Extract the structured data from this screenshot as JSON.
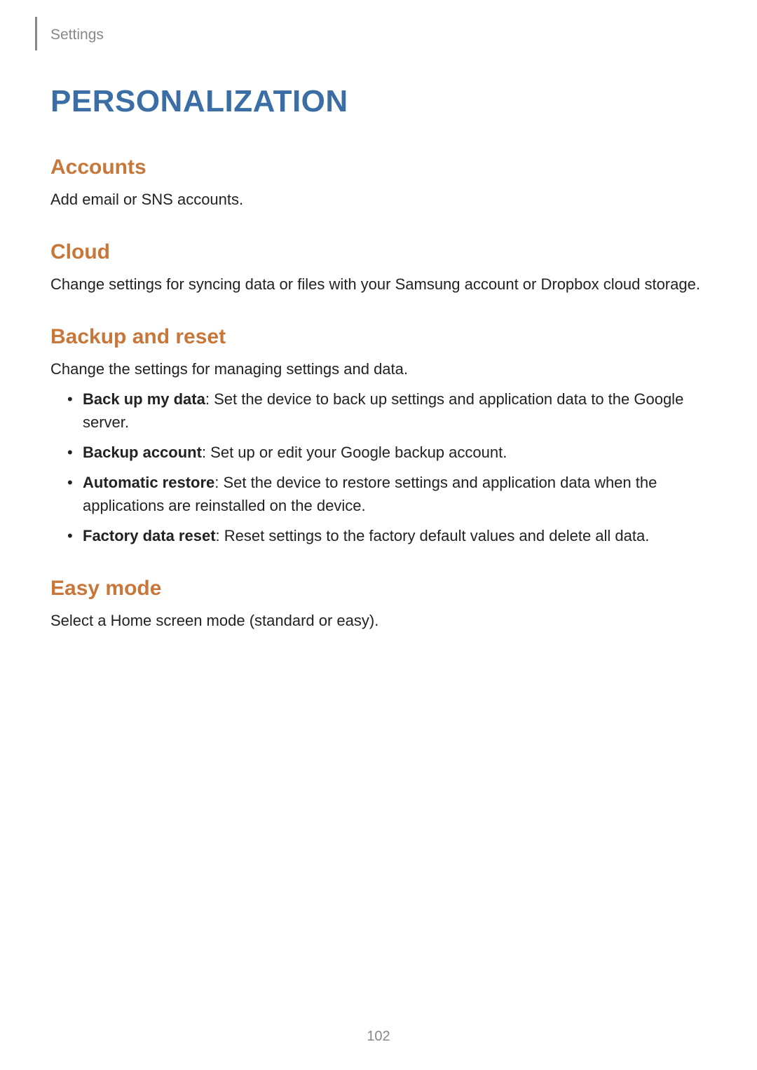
{
  "breadcrumb": "Settings",
  "main_heading": "PERSONALIZATION",
  "sections": {
    "accounts": {
      "heading": "Accounts",
      "body": "Add email or SNS accounts."
    },
    "cloud": {
      "heading": "Cloud",
      "body": "Change settings for syncing data or files with your Samsung account or Dropbox cloud storage."
    },
    "backup": {
      "heading": "Backup and reset",
      "body": "Change the settings for managing settings and data.",
      "items": [
        {
          "bold": "Back up my data",
          "text": ": Set the device to back up settings and application data to the Google server."
        },
        {
          "bold": "Backup account",
          "text": ": Set up or edit your Google backup account."
        },
        {
          "bold": "Automatic restore",
          "text": ": Set the device to restore settings and application data when the applications are reinstalled on the device."
        },
        {
          "bold": "Factory data reset",
          "text": ": Reset settings to the factory default values and delete all data."
        }
      ]
    },
    "easymode": {
      "heading": "Easy mode",
      "body": "Select a Home screen mode (standard or easy)."
    }
  },
  "page_number": "102"
}
